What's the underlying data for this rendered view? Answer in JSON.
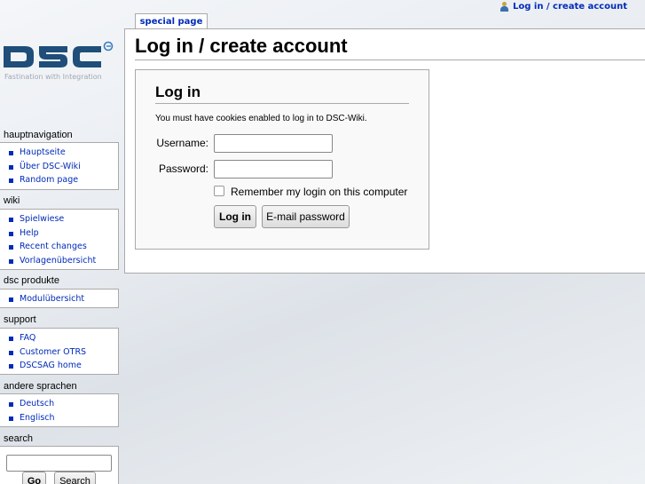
{
  "header": {
    "personal_link": "Log in / create account",
    "tab_label": "special page"
  },
  "logo": {
    "text": "DSC",
    "tagline": "Fastination with Integration",
    "color": "#1f4e7a"
  },
  "main": {
    "title": "Log in / create account",
    "login": {
      "heading": "Log in",
      "cookie_note": "You must have cookies enabled to log in to DSC-Wiki.",
      "username_label": "Username:",
      "username_value": "",
      "password_label": "Password:",
      "password_value": "",
      "remember_label": "Remember my login on this computer",
      "remember_checked": false,
      "login_button": "Log in",
      "email_button": "E-mail password"
    }
  },
  "sidebar": {
    "sections": [
      {
        "title": "hauptnavigation",
        "items": [
          "Hauptseite",
          "Über DSC-Wiki",
          "Random page"
        ]
      },
      {
        "title": "wiki",
        "items": [
          "Spielwiese",
          "Help",
          "Recent changes",
          "Vorlagenübersicht"
        ]
      },
      {
        "title": "dsc produkte",
        "items": [
          "Modulübersicht"
        ]
      },
      {
        "title": "support",
        "items": [
          "FAQ",
          "Customer OTRS",
          "DSCSAG home"
        ]
      },
      {
        "title": "andere sprachen",
        "items": [
          "Deutsch",
          "Englisch"
        ]
      }
    ],
    "search": {
      "title": "search",
      "value": "",
      "go_button": "Go",
      "search_button": "Search"
    }
  },
  "colors": {
    "link": "#002bb8",
    "border": "#aaaaaa"
  }
}
